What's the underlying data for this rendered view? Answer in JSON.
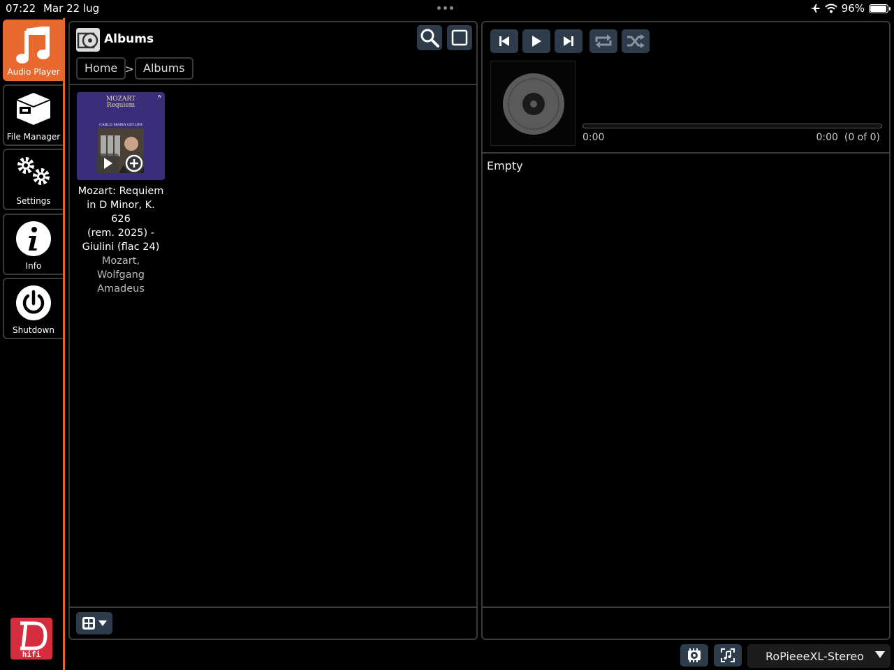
{
  "status_bar": {
    "time": "07:22",
    "date": "Mar 22 lug",
    "battery": "96%",
    "battery_level": 0.96,
    "icons": [
      "airplane-icon",
      "wifi-icon",
      "battery-icon"
    ]
  },
  "sidebar": {
    "items": [
      {
        "label": "Audio Player",
        "icon": "music-note-icon",
        "active": true
      },
      {
        "label": "File Manager",
        "icon": "box-icon",
        "active": false
      },
      {
        "label": "Settings",
        "icon": "gears-icon",
        "active": false
      },
      {
        "label": "Info",
        "icon": "info-icon",
        "active": false
      },
      {
        "label": "Shutdown",
        "icon": "power-icon",
        "active": false
      }
    ],
    "logo_text": "hifi"
  },
  "library": {
    "title": "Albums",
    "breadcrumb": [
      "Home",
      "Albums"
    ],
    "breadcrumb_separator": ">",
    "albums": [
      {
        "title": "Mozart: Requiem in D Minor, K. 626 (rem. 2025) - Giulini (flac 24)",
        "title_lines": [
          "Mozart: Requiem",
          "in D Minor, K. 626",
          "(rem. 2025) -",
          "Giulini (flac 24)"
        ],
        "artist_lines": [
          "Mozart, Wolfgang",
          "Amadeus"
        ],
        "cover_title": [
          "MOZART",
          "Requiem"
        ],
        "cover_subtitle": "CARLO MARIA GIULINI",
        "cover_color": "#3a2d7a"
      }
    ]
  },
  "player": {
    "position": "0:00",
    "duration": "0:00",
    "queue_count": "(0 of 0)",
    "queue_status": "Empty"
  },
  "bottom": {
    "zone": "RoPieeeXL-Stereo"
  },
  "colors": {
    "accent": "#e8692f",
    "button": "#2e3b4b",
    "border": "#3a3a3a",
    "logo": "#d32d3e"
  }
}
